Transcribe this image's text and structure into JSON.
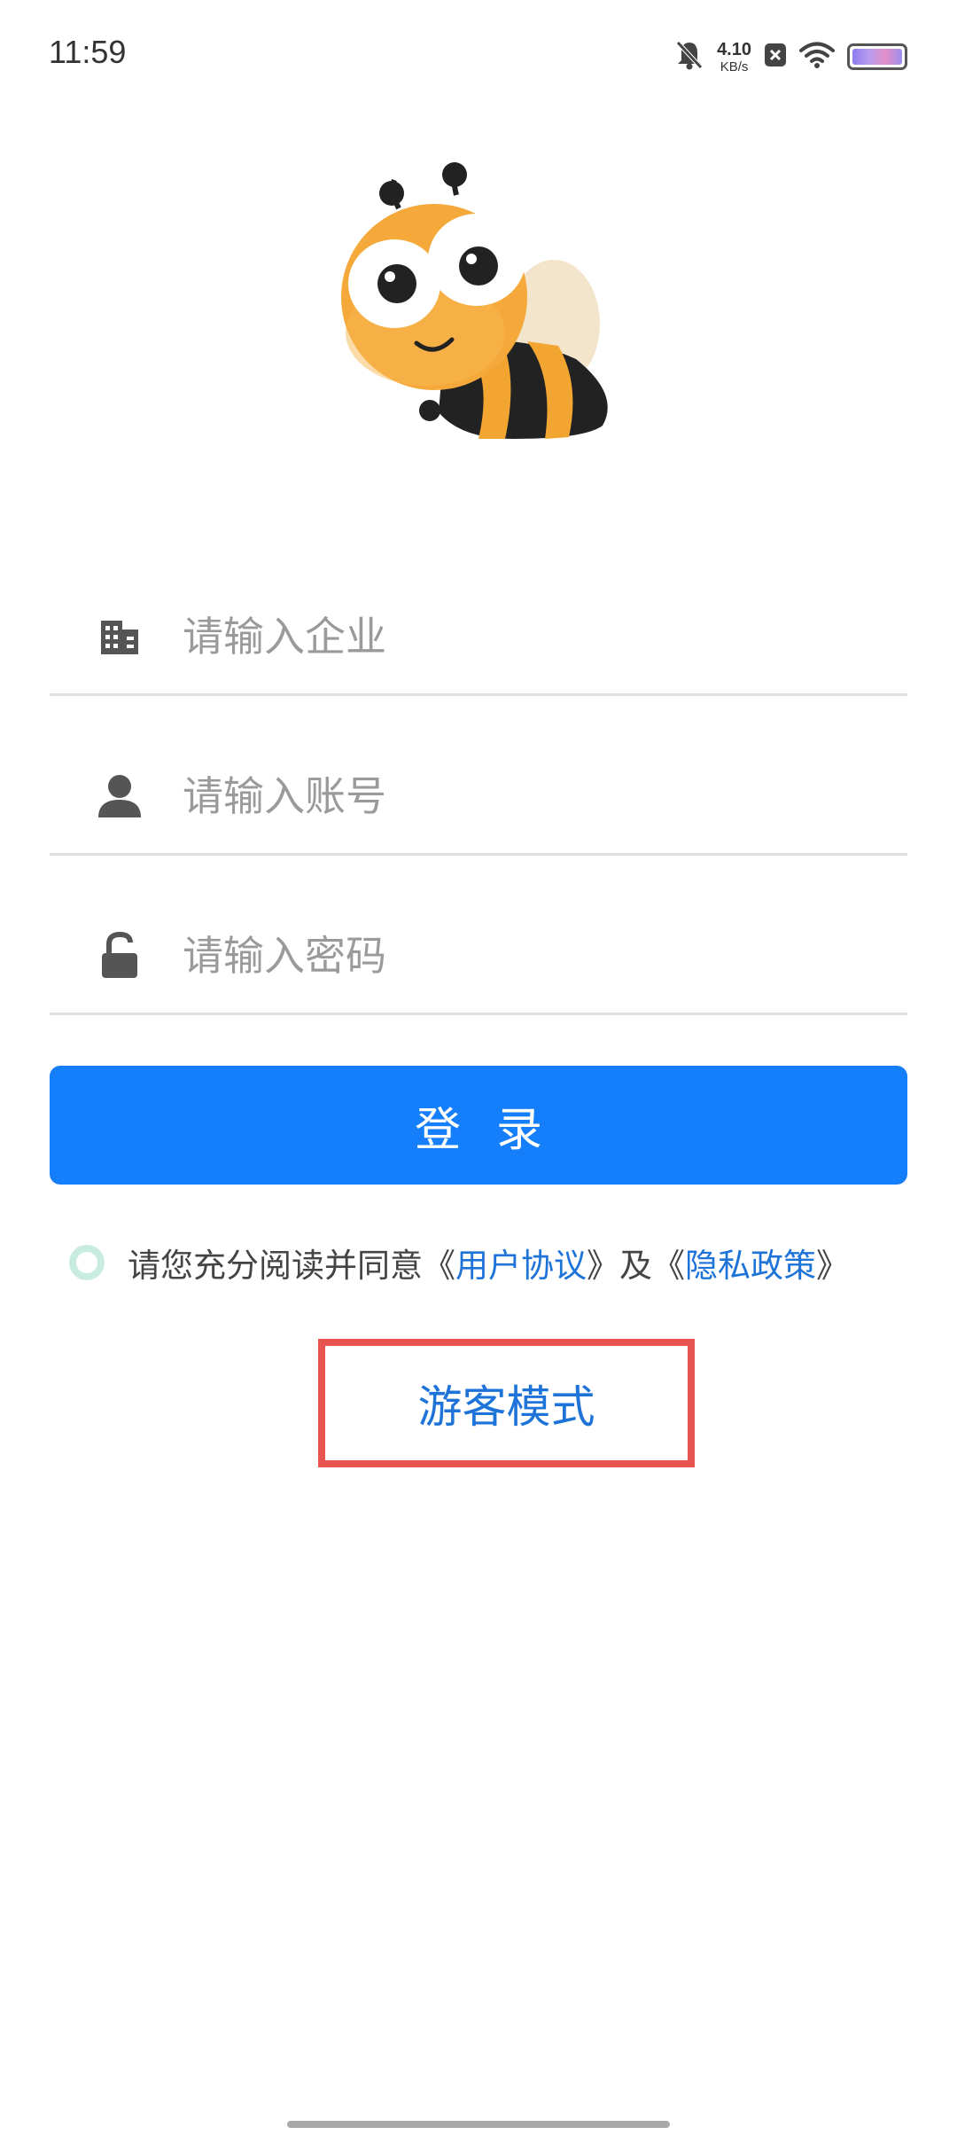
{
  "status_bar": {
    "time": "11:59",
    "net_speed_value": "4.10",
    "net_speed_unit": "KB/s",
    "icons": [
      "bell-muted-icon",
      "close-box-icon",
      "wifi-icon",
      "battery-icon"
    ]
  },
  "form": {
    "company_placeholder": "请输入企业",
    "account_placeholder": "请输入账号",
    "password_placeholder": "请输入密码",
    "company_icon": "building-icon",
    "account_icon": "user-icon",
    "password_icon": "lock-open-icon"
  },
  "login_button": {
    "label": "登录"
  },
  "agreement": {
    "prefix": "请您充分阅读并同意",
    "left_bracket_1": "《",
    "user_agreement": "用户协议",
    "right_bracket_1": "》",
    "and_text": "及",
    "left_bracket_2": "《",
    "privacy_policy": "隐私政策",
    "right_bracket_2": "》"
  },
  "guest_mode": {
    "label": "游客模式"
  },
  "colors": {
    "primary": "#157efb",
    "link": "#1d73d8",
    "highlight_border": "#e85550",
    "divider": "#e0e0e0"
  }
}
